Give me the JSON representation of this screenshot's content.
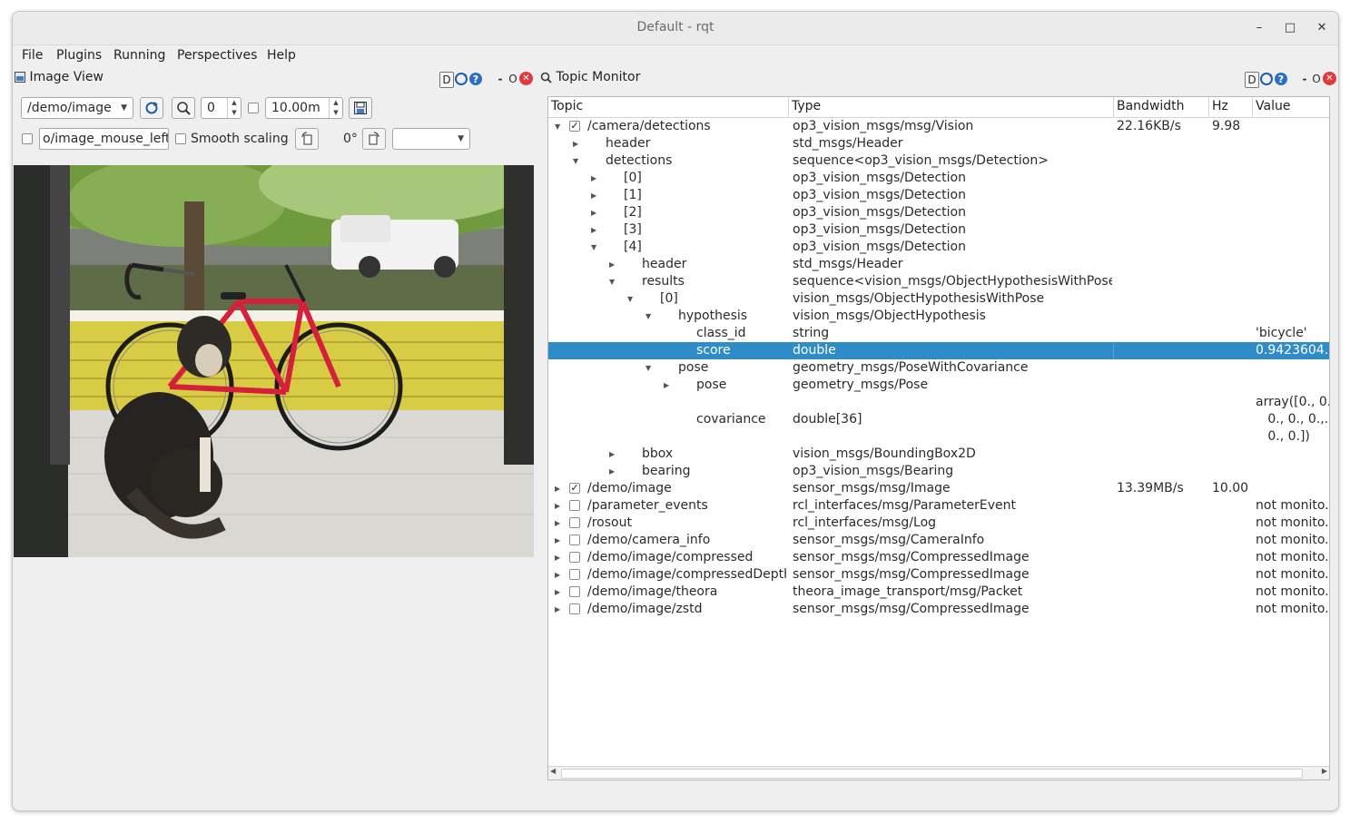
{
  "window": {
    "title": "Default - rqt",
    "minimize": "–",
    "maximize": "□",
    "close": "✕"
  },
  "menubar": [
    "File",
    "Plugins",
    "Running",
    "Perspectives",
    "Help"
  ],
  "image_view": {
    "title": "Image View",
    "dock_d": "D",
    "dock_o": "O",
    "topic": "/demo/image",
    "zoom_value": "0",
    "max_depth": "10.00m",
    "mouse_topic": "o/image_mouse_left",
    "smooth_label": "Smooth scaling",
    "rotation": "0°",
    "rotate_combo": ""
  },
  "topic_monitor": {
    "title": "Topic Monitor",
    "dock_d": "D",
    "dock_o": "O",
    "headers": {
      "topic": "Topic",
      "type": "Type",
      "bandwidth": "Bandwidth",
      "hz": "Hz",
      "value": "Value"
    },
    "rows": [
      {
        "indent": 0,
        "tri": "down",
        "check": true,
        "topic": "/camera/detections",
        "type": "op3_vision_msgs/msg/Vision",
        "bw": "22.16KB/s",
        "hz": "9.98",
        "value": ""
      },
      {
        "indent": 1,
        "tri": "right",
        "topic": "header",
        "type": "std_msgs/Header",
        "value": ""
      },
      {
        "indent": 1,
        "tri": "down",
        "topic": "detections",
        "type": "sequence<op3_vision_msgs/Detection>",
        "value": ""
      },
      {
        "indent": 2,
        "tri": "right",
        "topic": "[0]",
        "type": "op3_vision_msgs/Detection",
        "value": ""
      },
      {
        "indent": 2,
        "tri": "right",
        "topic": "[1]",
        "type": "op3_vision_msgs/Detection",
        "value": ""
      },
      {
        "indent": 2,
        "tri": "right",
        "topic": "[2]",
        "type": "op3_vision_msgs/Detection",
        "value": ""
      },
      {
        "indent": 2,
        "tri": "right",
        "topic": "[3]",
        "type": "op3_vision_msgs/Detection",
        "value": ""
      },
      {
        "indent": 2,
        "tri": "down",
        "topic": "[4]",
        "type": "op3_vision_msgs/Detection",
        "value": ""
      },
      {
        "indent": 3,
        "tri": "right",
        "topic": "header",
        "type": "std_msgs/Header",
        "value": ""
      },
      {
        "indent": 3,
        "tri": "down",
        "topic": "results",
        "type": "sequence<vision_msgs/ObjectHypothesisWithPose>",
        "value": ""
      },
      {
        "indent": 4,
        "tri": "down",
        "topic": "[0]",
        "type": "vision_msgs/ObjectHypothesisWithPose",
        "value": ""
      },
      {
        "indent": 5,
        "tri": "down",
        "topic": "hypothesis",
        "type": "vision_msgs/ObjectHypothesis",
        "value": ""
      },
      {
        "indent": 6,
        "topic": "class_id",
        "type": "string",
        "value": "'bicycle'"
      },
      {
        "indent": 6,
        "topic": "score",
        "type": "double",
        "value": "0.9423604..",
        "selected": true
      },
      {
        "indent": 5,
        "tri": "down",
        "topic": "pose",
        "type": "geometry_msgs/PoseWithCovariance",
        "value": ""
      },
      {
        "indent": 6,
        "tri": "right",
        "topic": "pose",
        "type": "geometry_msgs/Pose",
        "value": ""
      },
      {
        "indent": 6,
        "topic": "covariance",
        "type": "double[36]",
        "value_lines": [
          "array([0., 0.,.",
          "   0., 0., 0.,.",
          "   0., 0.])"
        ],
        "tall": true
      },
      {
        "indent": 3,
        "tri": "right",
        "topic": "bbox",
        "type": "vision_msgs/BoundingBox2D",
        "value": ""
      },
      {
        "indent": 3,
        "tri": "right",
        "topic": "bearing",
        "type": "op3_vision_msgs/Bearing",
        "value": ""
      },
      {
        "indent": 0,
        "tri": "right",
        "check": true,
        "topic": "/demo/image",
        "type": "sensor_msgs/msg/Image",
        "bw": "13.39MB/s",
        "hz": "10.00",
        "value": ""
      },
      {
        "indent": 0,
        "tri": "right",
        "check": false,
        "topic": "/parameter_events",
        "type": "rcl_interfaces/msg/ParameterEvent",
        "value": "not monito."
      },
      {
        "indent": 0,
        "tri": "right",
        "check": false,
        "topic": "/rosout",
        "type": "rcl_interfaces/msg/Log",
        "value": "not monito."
      },
      {
        "indent": 0,
        "tri": "right",
        "check": false,
        "topic": "/demo/camera_info",
        "type": "sensor_msgs/msg/CameraInfo",
        "value": "not monito."
      },
      {
        "indent": 0,
        "tri": "right",
        "check": false,
        "topic": "/demo/image/compressed",
        "type": "sensor_msgs/msg/CompressedImage",
        "value": "not monito."
      },
      {
        "indent": 0,
        "tri": "right",
        "check": false,
        "topic": "/demo/image/compressedDepth",
        "type": "sensor_msgs/msg/CompressedImage",
        "value": "not monito."
      },
      {
        "indent": 0,
        "tri": "right",
        "check": false,
        "topic": "/demo/image/theora",
        "type": "theora_image_transport/msg/Packet",
        "value": "not monito."
      },
      {
        "indent": 0,
        "tri": "right",
        "check": false,
        "topic": "/demo/image/zstd",
        "type": "sensor_msgs/msg/CompressedImage",
        "value": "not monito."
      }
    ]
  }
}
